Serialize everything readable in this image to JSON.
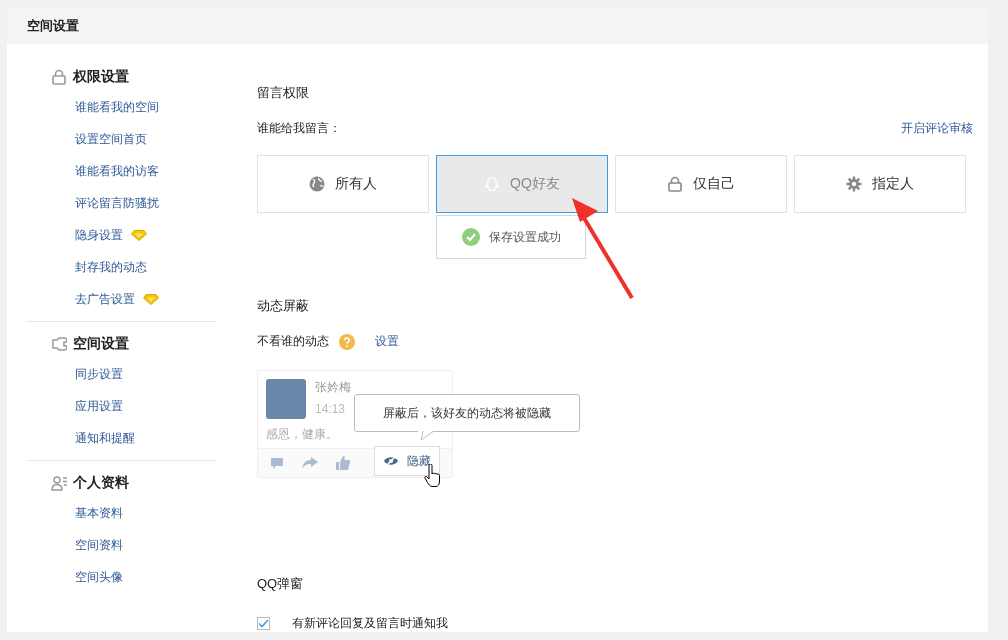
{
  "page_title": "空间设置",
  "sidebar": {
    "sections": [
      {
        "title": "权限设置",
        "items": [
          {
            "label": "谁能看我的空间",
            "vip": false
          },
          {
            "label": "设置空间首页",
            "vip": false
          },
          {
            "label": "谁能看我的访客",
            "vip": false
          },
          {
            "label": "评论留言防骚扰",
            "vip": false
          },
          {
            "label": "隐身设置",
            "vip": true
          },
          {
            "label": "封存我的动态",
            "vip": false
          },
          {
            "label": "去广告设置",
            "vip": true
          }
        ]
      },
      {
        "title": "空间设置",
        "items": [
          {
            "label": "同步设置",
            "vip": false
          },
          {
            "label": "应用设置",
            "vip": false
          },
          {
            "label": "通知和提醒",
            "vip": false
          }
        ]
      },
      {
        "title": "个人资料",
        "items": [
          {
            "label": "基本资料",
            "vip": false
          },
          {
            "label": "空间资料",
            "vip": false
          },
          {
            "label": "空间头像",
            "vip": false
          }
        ]
      }
    ]
  },
  "message_permission": {
    "title": "留言权限",
    "prompt": "谁能给我留言：",
    "review_link": "开启评论审核",
    "options": [
      {
        "label": "所有人",
        "selected": false
      },
      {
        "label": "QQ好友",
        "selected": true
      },
      {
        "label": "仅自己",
        "selected": false
      },
      {
        "label": "指定人",
        "selected": false
      }
    ],
    "toast": "保存设置成功"
  },
  "feed_block": {
    "title": "动态屏蔽",
    "label": "不看谁的动态",
    "settings_link": "设置",
    "example": {
      "name": "张妗梅",
      "time": "14:13",
      "text": "感恩，健康。",
      "hide_button": "隐藏",
      "tooltip": "屏蔽后，该好友的动态将被隐藏"
    }
  },
  "qq_popup": {
    "title": "QQ弹窗",
    "options": [
      {
        "label": "有新评论回复及留言时通知我",
        "checked": true
      }
    ]
  }
}
